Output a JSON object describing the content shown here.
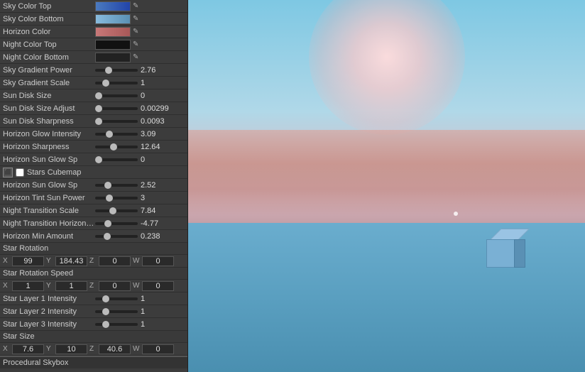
{
  "panel": {
    "title": "Procedural Skybox",
    "properties": [
      {
        "label": "Sky Color Top",
        "type": "color",
        "color": "#4a7abf",
        "color2": "#2244aa"
      },
      {
        "label": "Sky Color Bottom",
        "type": "color",
        "color": "#7ab0d4",
        "color2": "#5a90b4"
      },
      {
        "label": "Horizon Color",
        "type": "color",
        "color": "#c87878",
        "color2": "#a85858"
      },
      {
        "label": "Night Color Top",
        "type": "color",
        "color": "#111111",
        "color2": "#000000"
      },
      {
        "label": "Night Color Bottom",
        "type": "color",
        "color": "#222222",
        "color2": "#000000"
      },
      {
        "label": "Sky Gradient Power",
        "type": "slider",
        "value": "2.76"
      },
      {
        "label": "Sky Gradient Scale",
        "type": "slider",
        "value": "1"
      },
      {
        "label": "Sun Disk Size",
        "type": "slider",
        "value": "0"
      },
      {
        "label": "Sun Disk Size Adjust",
        "type": "slider",
        "value": "0.00299"
      },
      {
        "label": "Sun Disk Sharpness",
        "type": "slider",
        "value": "0.0093"
      },
      {
        "label": "Horizon Glow Intensity",
        "type": "slider",
        "value": "3.09"
      },
      {
        "label": "Horizon Sharpness",
        "type": "slider",
        "value": "12.64"
      },
      {
        "label": "Horizon Sun Glow Sp",
        "type": "slider",
        "value": "0"
      },
      {
        "label": "Horizon Sun Glow Sp",
        "type": "slider2",
        "value": "2.52"
      },
      {
        "label": "Horizon Tint Sun Power",
        "type": "slider",
        "value": "3"
      },
      {
        "label": "Night Transition Scale",
        "type": "slider",
        "value": "7.84"
      },
      {
        "label": "Night Transition Horizon Delay",
        "type": "slider",
        "value": "-4.77"
      },
      {
        "label": "Horizon Min Amount",
        "type": "slider",
        "value": "0.238"
      }
    ],
    "star_rotation": {
      "label": "Star Rotation",
      "x": "99",
      "y": "184.43",
      "z": "0",
      "w": "0"
    },
    "star_rotation_speed": {
      "label": "Star Rotation Speed",
      "x": "1",
      "y": "1",
      "z": "0",
      "w": "0"
    },
    "star_layers": [
      {
        "label": "Star Layer 1 Intensity",
        "value": "1"
      },
      {
        "label": "Star Layer 2 Intensity",
        "value": "1"
      },
      {
        "label": "Star Layer 3 Intensity",
        "value": "1"
      }
    ],
    "star_size": {
      "label": "Star Size",
      "x": "7.6",
      "y": "10",
      "z": "40.6",
      "w": "0"
    },
    "bottom_label": "Procedural Skybox"
  }
}
